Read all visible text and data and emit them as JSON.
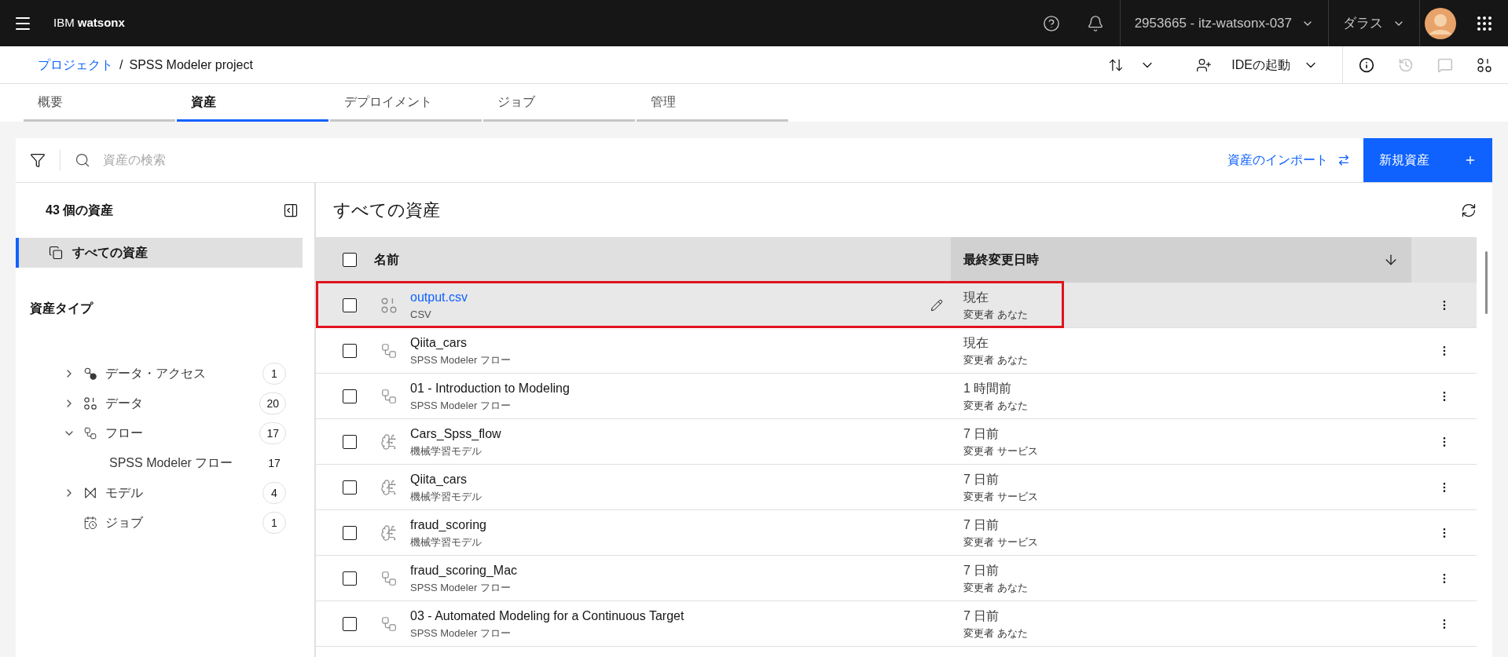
{
  "header": {
    "brand_prefix": "IBM",
    "brand_name": "watsonx",
    "account": "2953665 - itz-watsonx-037",
    "region": "ダラス"
  },
  "breadcrumb": {
    "parent": "プロジェクト",
    "separator": "/",
    "current": "SPSS Modeler project"
  },
  "project_actions": {
    "launch_ide": "IDEの起動",
    "side_icons": [
      {
        "kind": "info",
        "disabled": false
      },
      {
        "kind": "history",
        "disabled": true
      },
      {
        "kind": "comment",
        "disabled": true
      },
      {
        "kind": "data",
        "disabled": false
      }
    ]
  },
  "tabs": [
    {
      "label": "概要",
      "selected": false
    },
    {
      "label": "資産",
      "selected": true
    },
    {
      "label": "デプロイメント",
      "selected": false
    },
    {
      "label": "ジョブ",
      "selected": false
    },
    {
      "label": "管理",
      "selected": false
    }
  ],
  "toolbar": {
    "search_placeholder": "資産の検索",
    "import_link": "資産のインポート",
    "new_button": "新規資産"
  },
  "sidebar": {
    "count_title": "43 個の資産",
    "all_assets": {
      "label": "すべての資産",
      "selected": true
    },
    "types_heading": "資産タイプ",
    "types": [
      {
        "kind": "data_access",
        "label": "データ・アクセス",
        "count": "1",
        "expanded": false
      },
      {
        "kind": "data",
        "label": "データ",
        "count": "20",
        "expanded": false
      },
      {
        "kind": "flow",
        "label": "フロー",
        "count": "17",
        "expanded": true,
        "children": [
          {
            "label": "SPSS Modeler フロー",
            "count": "17"
          }
        ]
      },
      {
        "kind": "model",
        "label": "モデル",
        "count": "4",
        "expanded": false
      },
      {
        "kind": "job",
        "label": "ジョブ",
        "count": "1"
      }
    ]
  },
  "main": {
    "title": "すべての資産",
    "table": {
      "select_all_checked": false,
      "columns": [
        {
          "label": "名前",
          "sorted": false
        },
        {
          "label": "最終変更日時",
          "sorted": true
        }
      ],
      "rows": [
        {
          "kind": "data",
          "name": "output.csv",
          "type": "CSV",
          "modified": "現在",
          "modified_by": "変更者 あなた",
          "selected": true,
          "checked": false,
          "highlighted": true
        },
        {
          "kind": "flow",
          "name": "Qiita_cars",
          "type": "SPSS Modeler フロー",
          "modified": "現在",
          "modified_by": "変更者 あなた",
          "selected": false,
          "checked": false,
          "highlighted": false
        },
        {
          "kind": "flow",
          "name": "01 - Introduction to Modeling",
          "type": "SPSS Modeler フロー",
          "modified": "1 時間前",
          "modified_by": "変更者 あなた",
          "selected": false,
          "checked": false,
          "highlighted": false
        },
        {
          "kind": "model",
          "name": "Cars_Spss_flow",
          "type": "機械学習モデル",
          "modified": "7 日前",
          "modified_by": "変更者 サービス",
          "selected": false,
          "checked": false,
          "highlighted": false
        },
        {
          "kind": "model",
          "name": "Qiita_cars",
          "type": "機械学習モデル",
          "modified": "7 日前",
          "modified_by": "変更者 サービス",
          "selected": false,
          "checked": false,
          "highlighted": false
        },
        {
          "kind": "model",
          "name": "fraud_scoring",
          "type": "機械学習モデル",
          "modified": "7 日前",
          "modified_by": "変更者 サービス",
          "selected": false,
          "checked": false,
          "highlighted": false
        },
        {
          "kind": "flow",
          "name": "fraud_scoring_Mac",
          "type": "SPSS Modeler フロー",
          "modified": "7 日前",
          "modified_by": "変更者 あなた",
          "selected": false,
          "checked": false,
          "highlighted": false
        },
        {
          "kind": "flow",
          "name": "03 - Automated Modeling for a Continuous Target",
          "type": "SPSS Modeler フロー",
          "modified": "7 日前",
          "modified_by": "変更者 あなた",
          "selected": false,
          "checked": false,
          "highlighted": false
        }
      ]
    }
  }
}
